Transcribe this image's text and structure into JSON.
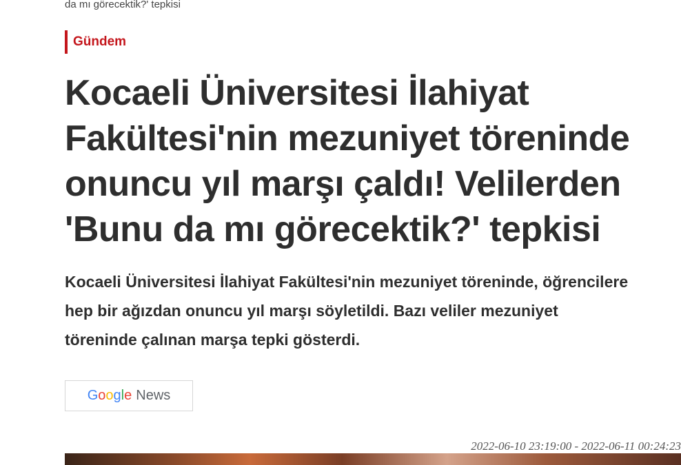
{
  "top_snippet": "da mı görecektik?' tepkisi",
  "category": "Gündem",
  "headline": "Kocaeli Üniversitesi İlahiyat Fakültesi'nin mezuniyet töreninde onuncu yıl marşı çaldı! Velilerden 'Bunu da mı görecektik?' tepkisi",
  "summary": "Kocaeli Üniversitesi İlahiyat Fakültesi'nin mezuniyet töreninde, öğrencilere hep bir ağızdan onuncu yıl marşı söyletildi. Bazı veliler mezuniyet töreninde çalınan marşa tepki gösterdi.",
  "google_news": {
    "letters": [
      {
        "ch": "G",
        "color": "#4285F4"
      },
      {
        "ch": "o",
        "color": "#EA4335"
      },
      {
        "ch": "o",
        "color": "#FBBC05"
      },
      {
        "ch": "g",
        "color": "#4285F4"
      },
      {
        "ch": "l",
        "color": "#34A853"
      },
      {
        "ch": "e",
        "color": "#EA4335"
      }
    ],
    "news_label": "News"
  },
  "timestamp": "2022-06-10 23:19:00 - 2022-06-11 00:24:23",
  "colors": {
    "accent": "#c4161c",
    "text": "#2e2e2e"
  }
}
